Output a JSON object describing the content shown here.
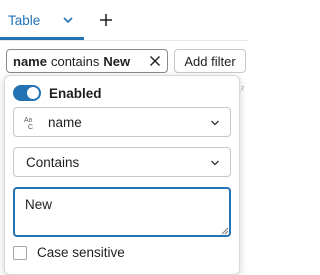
{
  "colors": {
    "accent": "#2272b4",
    "text": "#1f1f1f",
    "border": "#c8c8c8"
  },
  "tabs": {
    "active_label": "Table",
    "active_icon": "chevron-down-icon",
    "add_icon": "plus-icon"
  },
  "filter_chip": {
    "column": "name",
    "operator": "contains",
    "value": "New",
    "close_icon": "close-icon"
  },
  "add_filter_label": "Add filter",
  "background_hint": "1²",
  "popover": {
    "enabled_label": "Enabled",
    "enabled": true,
    "column_select": {
      "type_icon": "string-type-icon",
      "value": "name"
    },
    "operator_select": {
      "value": "Contains"
    },
    "value_input": "New",
    "case_sensitive_label": "Case sensitive",
    "case_sensitive": false
  }
}
